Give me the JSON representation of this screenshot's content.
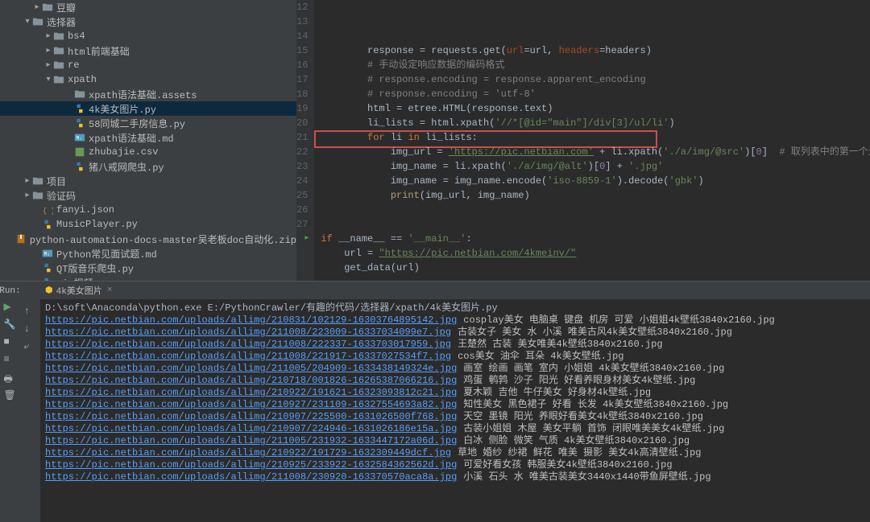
{
  "tree": {
    "items": [
      {
        "indent": 40,
        "arrow": "▸",
        "icon": "folder",
        "label": "豆瓣"
      },
      {
        "indent": 28,
        "arrow": "▾",
        "icon": "folder",
        "label": "选择器"
      },
      {
        "indent": 54,
        "arrow": "▸",
        "icon": "folder",
        "label": "bs4"
      },
      {
        "indent": 54,
        "arrow": "▸",
        "icon": "folder",
        "label": "html前端基础"
      },
      {
        "indent": 54,
        "arrow": "▸",
        "icon": "folder",
        "label": "re"
      },
      {
        "indent": 54,
        "arrow": "▾",
        "icon": "folder",
        "label": "xpath"
      },
      {
        "indent": 80,
        "arrow": "",
        "icon": "folder",
        "label": "xpath语法基础.assets"
      },
      {
        "indent": 80,
        "arrow": "",
        "icon": "py",
        "label": "4k美女图片.py",
        "sel": true
      },
      {
        "indent": 80,
        "arrow": "",
        "icon": "py",
        "label": "58同城二手房信息.py"
      },
      {
        "indent": 80,
        "arrow": "",
        "icon": "md",
        "label": "xpath语法基础.md"
      },
      {
        "indent": 80,
        "arrow": "",
        "icon": "csv",
        "label": "zhubajie.csv"
      },
      {
        "indent": 80,
        "arrow": "",
        "icon": "py",
        "label": "猪八戒网爬虫.py"
      },
      {
        "indent": 28,
        "arrow": "▸",
        "icon": "folder",
        "label": "项目"
      },
      {
        "indent": 28,
        "arrow": "▸",
        "icon": "folder",
        "label": "验证码"
      },
      {
        "indent": 40,
        "arrow": "",
        "icon": "json",
        "label": "fanyi.json"
      },
      {
        "indent": 40,
        "arrow": "",
        "icon": "py",
        "label": "MusicPlayer.py"
      },
      {
        "indent": 40,
        "arrow": "",
        "icon": "zip",
        "label": "python-automation-docs-master吴老板doc自动化.zip"
      },
      {
        "indent": 40,
        "arrow": "",
        "icon": "md",
        "label": "Python常见面试题.md"
      },
      {
        "indent": 40,
        "arrow": "",
        "icon": "py",
        "label": "QT版音乐爬虫.py"
      },
      {
        "indent": 40,
        "arrow": "",
        "icon": "py",
        "label": "vip视频.py"
      }
    ]
  },
  "editor": {
    "first_line": 12,
    "lines": [
      {
        "n": 12,
        "html": "        response = requests.get(<span class='c-par'>url</span>=url, <span class='c-par'>headers</span>=headers)"
      },
      {
        "n": 13,
        "html": "        <span class='c-cmt'># 手动设定响应数据的编码格式</span>"
      },
      {
        "n": 14,
        "html": "        <span class='c-cmt'># response.encoding = response.apparent_encoding</span>"
      },
      {
        "n": 15,
        "html": "        <span class='c-cmt'># response.encoding = 'utf-8'</span>"
      },
      {
        "n": 16,
        "html": "        html = etree.HTML(response.text)"
      },
      {
        "n": 17,
        "html": "        li_lists = html.xpath(<span class='c-str'>'//*[@id=\"main\"]/div[3]/ul/li'</span>)"
      },
      {
        "n": 18,
        "html": "        <span class='c-kw'>for</span> li <span class='c-kw'>in</span> li_lists:"
      },
      {
        "n": 19,
        "html": "            img_url = <span class='c-lnk'>'https://pic.netbian.com'</span> + li.xpath(<span class='c-str'>'./a/img/@src'</span>)[<span class='c-def'>0</span>]  <span class='c-cmt'># 取列表中的第一个元</span>"
      },
      {
        "n": 20,
        "html": "            img_name = li.xpath(<span class='c-str'>'./a/img/@alt'</span>)[<span class='c-def'>0</span>] + <span class='c-str'>'.jpg'</span>"
      },
      {
        "n": 21,
        "html": "            img_name = img_name.encode(<span class='c-str'>'iso-8859-1'</span>).decode(<span class='c-str'>'gbk'</span>)"
      },
      {
        "n": 22,
        "html": "            <span class='c-fn'>print</span>(img_url, img_name)"
      },
      {
        "n": 23,
        "html": ""
      },
      {
        "n": 24,
        "html": ""
      },
      {
        "n": 25,
        "html": "<span class='glyph'>▸</span><span class='c-kw'>if</span> __name__ == <span class='c-str'>'__main__'</span>:"
      },
      {
        "n": 26,
        "html": "    url = <span class='c-lnk'>\"https://pic.netbian.com/4kmeinv/\"</span>"
      },
      {
        "n": 27,
        "html": "    get_data(url)"
      }
    ]
  },
  "run": {
    "label": "Run:",
    "tab": "4k美女图片",
    "first_line": "D:\\soft\\Anaconda\\python.exe E:/PythonCrawler/有趣的代码/选择器/xpath/4k美女图片.py",
    "rows": [
      {
        "url": "https://pic.netbian.com/uploads/allimg/210831/102129-16303764895142.jpg",
        "desc": "cosplay美女 电脑桌 键盘 机房 可爱 小姐姐4k壁纸3840x2160.jpg"
      },
      {
        "url": "https://pic.netbian.com/uploads/allimg/211008/223009-16337034099e7.jpg",
        "desc": "古装女子 美女 水 小溪 唯美古风4k美女壁纸3840x2160.jpg"
      },
      {
        "url": "https://pic.netbian.com/uploads/allimg/211008/222337-1633703017959.jpg",
        "desc": "王楚然 古装 美女唯美4k壁纸3840x2160.jpg"
      },
      {
        "url": "https://pic.netbian.com/uploads/allimg/211008/221917-16337027534f7.jpg",
        "desc": "cos美女 油伞 耳朵 4k美女壁纸.jpg"
      },
      {
        "url": "https://pic.netbian.com/uploads/allimg/211005/204909-1633438149324e.jpg",
        "desc": "画室 绘画 画笔 室内 小姐姐 4k美女壁纸3840x2160.jpg"
      },
      {
        "url": "https://pic.netbian.com/uploads/allimg/210718/001826-16265387066216.jpg",
        "desc": "鸡蛋 鹌鹑 沙子 阳光 好看养眼身材美女4k壁纸.jpg"
      },
      {
        "url": "https://pic.netbian.com/uploads/allimg/210922/191621-16323093812c21.jpg",
        "desc": "夏木颖 吉他 牛仔美女 好身材4k壁纸.jpg"
      },
      {
        "url": "https://pic.netbian.com/uploads/allimg/210927/231109-16327554693a82.jpg",
        "desc": "知性美女 黑色裙子 好看 长发 4k美女壁纸3840x2160.jpg"
      },
      {
        "url": "https://pic.netbian.com/uploads/allimg/210907/225500-1631026500f768.jpg",
        "desc": "天空 墨镜 阳光 养眼好看美女4k壁纸3840x2160.jpg"
      },
      {
        "url": "https://pic.netbian.com/uploads/allimg/210907/224946-1631026186e15a.jpg",
        "desc": "古装小姐姐 木屋 美女平躺 首饰 闭眼唯美美女4k壁纸.jpg"
      },
      {
        "url": "https://pic.netbian.com/uploads/allimg/211005/231932-1633447172a06d.jpg",
        "desc": "白冰 侧脸 微笑 气质 4k美女壁纸3840x2160.jpg"
      },
      {
        "url": "https://pic.netbian.com/uploads/allimg/210922/191729-1632309449dcf.jpg",
        "desc": "草地 婚纱 纱裙 鲜花 唯美 摄影 美女4k高清壁纸.jpg"
      },
      {
        "url": "https://pic.netbian.com/uploads/allimg/210925/233922-1632584362562d.jpg",
        "desc": "可爱好看女孩 韩服美女4k壁纸3840x2160.jpg"
      },
      {
        "url": "https://pic.netbian.com/uploads/allimg/211008/230920-163370570aca8a.jpg",
        "desc": "小溪 石头 水 唯美古装美女3440x1440带鱼屏壁纸.jpg"
      }
    ]
  }
}
